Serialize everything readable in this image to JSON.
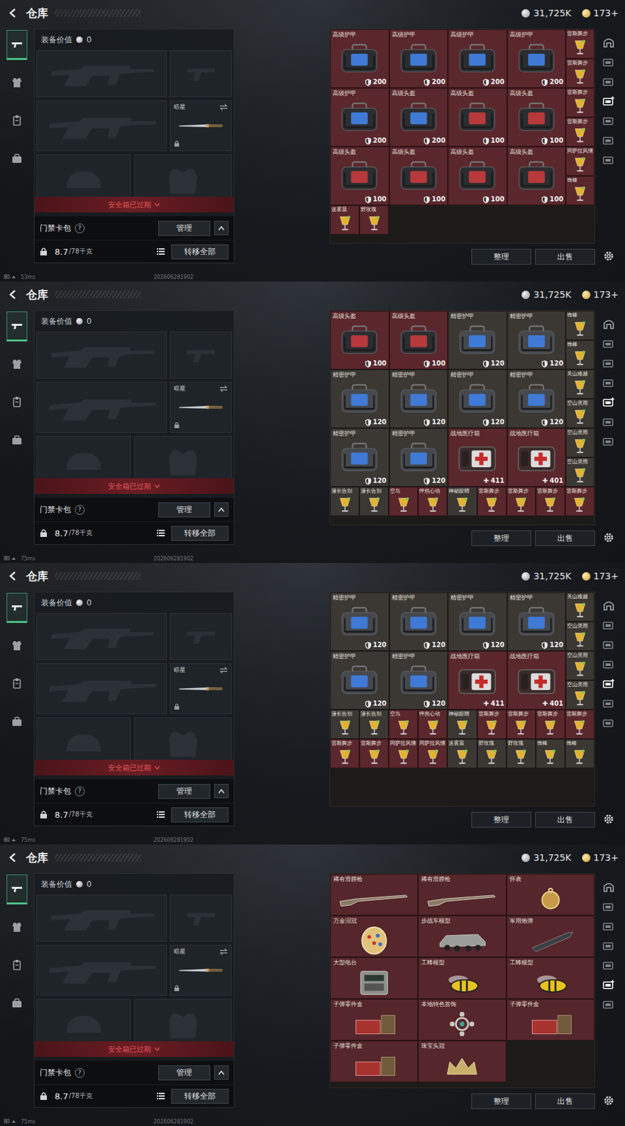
{
  "screens": [
    {
      "topbar": {
        "title": "仓库",
        "currencies": [
          {
            "kind": "silver",
            "value": "31,725K"
          },
          {
            "kind": "gold",
            "value": "173+"
          }
        ]
      },
      "nav": [
        {
          "kind": "weapon",
          "selected": true
        },
        {
          "kind": "armor",
          "selected": false
        },
        {
          "kind": "clipboard",
          "selected": false
        },
        {
          "kind": "case",
          "selected": false
        }
      ],
      "equipment": {
        "value_label": "装备价值",
        "value": "0",
        "slots": [
          {
            "kind": "rifle"
          },
          {
            "kind": "pistol"
          },
          {
            "kind": "rifle"
          },
          {
            "kind": "melee",
            "label": "暗星",
            "locked": true
          },
          {
            "kind": "helmet"
          },
          {
            "kind": "armor"
          }
        ],
        "warning": "安全箱已过期",
        "keycard": {
          "label": "门禁卡包",
          "help": "?",
          "manage": "管理"
        },
        "weight": "8.7",
        "capacity": "/78千克",
        "transfer": "转移全部"
      },
      "stash": {
        "layout": "gear",
        "big": [
          {
            "label": "高级护甲",
            "value": "200",
            "kind": "armor",
            "color": "#5a272d"
          },
          {
            "label": "高级护甲",
            "value": "200",
            "kind": "armor",
            "color": "#5a272d"
          },
          {
            "label": "高级护甲",
            "value": "200",
            "kind": "armor",
            "color": "#5a272d"
          },
          {
            "label": "高级护甲",
            "value": "200",
            "kind": "armor",
            "color": "#5a272d"
          },
          {
            "label": "高级护甲",
            "value": "200",
            "kind": "armor",
            "color": "#5a272d"
          },
          {
            "label": "高级头盔",
            "value": "200",
            "kind": "armor",
            "color": "#5a272d"
          },
          {
            "label": "高级头盔",
            "value": "100",
            "kind": "helmet",
            "color": "#5a272d"
          },
          {
            "label": "高级头盔",
            "value": "100",
            "kind": "helmet",
            "color": "#5a272d"
          },
          {
            "label": "高级头盔",
            "value": "100",
            "kind": "helmet",
            "color": "#5a272d"
          },
          {
            "label": "高级头盔",
            "value": "100",
            "kind": "helmet",
            "color": "#5a272d"
          },
          {
            "label": "高级头盔",
            "value": "100",
            "kind": "helmet",
            "color": "#5a272d"
          },
          {
            "label": "高级头盔",
            "value": "100",
            "kind": "helmet",
            "color": "#5a272d"
          }
        ],
        "side": [
          {
            "label": "雷斯舞步",
            "color": "#5a272d"
          },
          {
            "label": "雷斯舞步",
            "color": "#5a272d"
          },
          {
            "label": "雷斯舞步",
            "color": "#5a272d"
          },
          {
            "label": "雷斯舞步",
            "color": "#5a272d"
          },
          {
            "label": "同萨拉风情",
            "color": "#5a272d"
          },
          {
            "label": "饰棒",
            "color": "#5a272d"
          }
        ],
        "small": [
          {
            "label": "迷雾晨",
            "color": "#5a272d"
          },
          {
            "label": "野玫瑰",
            "color": "#5a272d"
          }
        ],
        "buttons": [
          "整理",
          "出售"
        ]
      },
      "tools": [
        {
          "highlighted": false
        },
        {
          "highlighted": false
        },
        {
          "highlighted": false
        },
        {
          "highlighted": true
        },
        {
          "highlighted": false
        },
        {
          "highlighted": false
        },
        {
          "highlighted": false
        }
      ],
      "status": {
        "ping": "53ms",
        "timestamp": "202606281902"
      }
    },
    {
      "topbar": {
        "title": "仓库",
        "currencies": [
          {
            "kind": "silver",
            "value": "31,725K"
          },
          {
            "kind": "gold",
            "value": "173+"
          }
        ]
      },
      "nav": [
        {
          "kind": "weapon",
          "selected": true
        },
        {
          "kind": "armor",
          "selected": false
        },
        {
          "kind": "clipboard",
          "selected": false
        },
        {
          "kind": "case",
          "selected": false
        }
      ],
      "equipment": {
        "value_label": "装备价值",
        "value": "0",
        "slots": [
          {
            "kind": "rifle"
          },
          {
            "kind": "pistol"
          },
          {
            "kind": "rifle"
          },
          {
            "kind": "melee",
            "label": "暗星",
            "locked": true
          },
          {
            "kind": "helmet"
          },
          {
            "kind": "armor"
          }
        ],
        "warning": "安全箱已过期",
        "keycard": {
          "label": "门禁卡包",
          "help": "?",
          "manage": "管理"
        },
        "weight": "8.7",
        "capacity": "/78千克",
        "transfer": "转移全部"
      },
      "stash": {
        "layout": "gear",
        "big": [
          {
            "label": "高级头盔",
            "value": "100",
            "kind": "helmet",
            "color": "#5a272d"
          },
          {
            "label": "高级头盔",
            "value": "100",
            "kind": "helmet",
            "color": "#5a272d"
          },
          {
            "label": "精密护甲",
            "value": "120",
            "kind": "precise",
            "color": "#3b3733"
          },
          {
            "label": "精密护甲",
            "value": "120",
            "kind": "precise",
            "color": "#3b3733"
          },
          {
            "label": "精密护甲",
            "value": "120",
            "kind": "precise",
            "color": "#3b3733"
          },
          {
            "label": "精密护甲",
            "value": "120",
            "kind": "precise",
            "color": "#3b3733"
          },
          {
            "label": "精密护甲",
            "value": "120",
            "kind": "precise",
            "color": "#3b3733"
          },
          {
            "label": "精密护甲",
            "value": "120",
            "kind": "precise",
            "color": "#3b3733"
          },
          {
            "label": "精密护甲",
            "value": "120",
            "kind": "precise",
            "color": "#3b3733"
          },
          {
            "label": "精密护甲",
            "value": "120",
            "kind": "precise",
            "color": "#3b3733"
          },
          {
            "label": "战地医疗箱",
            "value": "411",
            "mark": "✚",
            "kind": "medkit",
            "color": "#5a272d"
          },
          {
            "label": "战地医疗箱",
            "value": "401",
            "mark": "✚",
            "kind": "medkit",
            "color": "#5a272d"
          }
        ],
        "side": [
          {
            "label": "饰棒",
            "color": "#3b3733"
          },
          {
            "label": "饰棒",
            "color": "#3b3733"
          },
          {
            "label": "关山难越",
            "color": "#3b3733"
          },
          {
            "label": "空山灵雨",
            "color": "#3b3733"
          },
          {
            "label": "空山灵雨",
            "color": "#3b3733"
          },
          {
            "label": "空山灵雨",
            "color": "#3b3733"
          }
        ],
        "small": [
          {
            "label": "漫长告别",
            "color": "#3b3733"
          },
          {
            "label": "漫长告别",
            "color": "#3b3733"
          },
          {
            "label": "空岛",
            "color": "#5a272d"
          },
          {
            "label": "怦然心动",
            "color": "#5a272d"
          },
          {
            "label": "神秘眼睛",
            "color": "#3b3733"
          },
          {
            "label": "雷斯舞步",
            "color": "#5a272d"
          },
          {
            "label": "雷斯舞步",
            "color": "#5a272d"
          },
          {
            "label": "雷斯舞步",
            "color": "#5a272d"
          },
          {
            "label": "雷斯舞步",
            "color": "#5a272d"
          }
        ],
        "buttons": [
          "整理",
          "出售"
        ]
      },
      "tools": [
        {
          "highlighted": false
        },
        {
          "highlighted": false
        },
        {
          "highlighted": false
        },
        {
          "highlighted": false
        },
        {
          "highlighted": true
        },
        {
          "highlighted": false
        },
        {
          "highlighted": false
        }
      ],
      "status": {
        "ping": "75ms",
        "timestamp": "202606281902"
      }
    },
    {
      "topbar": {
        "title": "仓库",
        "currencies": [
          {
            "kind": "silver",
            "value": "31,725K"
          },
          {
            "kind": "gold",
            "value": "173+"
          }
        ]
      },
      "nav": [
        {
          "kind": "weapon",
          "selected": true
        },
        {
          "kind": "armor",
          "selected": false
        },
        {
          "kind": "clipboard",
          "selected": false
        },
        {
          "kind": "case",
          "selected": false
        }
      ],
      "equipment": {
        "value_label": "装备价值",
        "value": "0",
        "slots": [
          {
            "kind": "rifle"
          },
          {
            "kind": "pistol"
          },
          {
            "kind": "rifle"
          },
          {
            "kind": "melee",
            "label": "暗星",
            "locked": true
          },
          {
            "kind": "helmet"
          },
          {
            "kind": "armor"
          }
        ],
        "warning": "安全箱已过期",
        "keycard": {
          "label": "门禁卡包",
          "help": "?",
          "manage": "管理"
        },
        "weight": "8.7",
        "capacity": "/78千克",
        "transfer": "转移全部"
      },
      "stash": {
        "layout": "gear",
        "big": [
          {
            "label": "精密护甲",
            "value": "120",
            "kind": "precise",
            "color": "#3b3733"
          },
          {
            "label": "精密护甲",
            "value": "120",
            "kind": "precise",
            "color": "#3b3733"
          },
          {
            "label": "精密护甲",
            "value": "120",
            "kind": "precise",
            "color": "#3b3733"
          },
          {
            "label": "精密护甲",
            "value": "120",
            "kind": "precise",
            "color": "#3b3733"
          },
          {
            "label": "精密护甲",
            "value": "120",
            "kind": "precise",
            "color": "#3b3733"
          },
          {
            "label": "精密护甲",
            "value": "120",
            "kind": "precise",
            "color": "#3b3733"
          },
          {
            "label": "战地医疗箱",
            "value": "411",
            "mark": "✚",
            "kind": "medkit",
            "color": "#5a272d"
          },
          {
            "label": "战地医疗箱",
            "value": "401",
            "mark": "✚",
            "kind": "medkit",
            "color": "#5a272d"
          }
        ],
        "side": [
          {
            "label": "关山难越",
            "color": "#3b3733"
          },
          {
            "label": "空山灵雨",
            "color": "#3b3733"
          },
          {
            "label": "空山灵雨",
            "color": "#3b3733"
          },
          {
            "label": "空山灵雨",
            "color": "#3b3733"
          }
        ],
        "small": [
          {
            "label": "漫长告别",
            "color": "#3b3733"
          },
          {
            "label": "漫长告别",
            "color": "#3b3733"
          },
          {
            "label": "空岛",
            "color": "#5a272d"
          },
          {
            "label": "怦然心动",
            "color": "#5a272d"
          },
          {
            "label": "神秘眼睛",
            "color": "#3b3733"
          },
          {
            "label": "雷斯舞步",
            "color": "#5a272d"
          },
          {
            "label": "雷斯舞步",
            "color": "#5a272d"
          },
          {
            "label": "雷斯舞步",
            "color": "#5a272d"
          },
          {
            "label": "雷斯舞步",
            "color": "#5a272d"
          },
          {
            "label": "雷斯舞步",
            "color": "#5a272d"
          },
          {
            "label": "雷斯舞步",
            "color": "#5a272d"
          },
          {
            "label": "同萨拉风情",
            "color": "#5a272d"
          },
          {
            "label": "同萨拉风情",
            "color": "#5a272d"
          },
          {
            "label": "迷雾晨",
            "color": "#3b3733"
          },
          {
            "label": "野玫瑰",
            "color": "#3b3733"
          },
          {
            "label": "野玫瑰",
            "color": "#3b3733"
          },
          {
            "label": "饰棒",
            "color": "#3b3733"
          },
          {
            "label": "饰棒",
            "color": "#3b3733"
          }
        ],
        "buttons": [
          "整理",
          "出售"
        ]
      },
      "tools": [
        {
          "highlighted": false
        },
        {
          "highlighted": false
        },
        {
          "highlighted": false
        },
        {
          "highlighted": false
        },
        {
          "highlighted": true
        },
        {
          "highlighted": false
        },
        {
          "highlighted": false
        }
      ],
      "status": {
        "ping": "75ms",
        "timestamp": "202606281902"
      }
    },
    {
      "topbar": {
        "title": "仓库",
        "currencies": [
          {
            "kind": "silver",
            "value": "31,725K"
          },
          {
            "kind": "gold",
            "value": "173+"
          }
        ]
      },
      "nav": [
        {
          "kind": "weapon",
          "selected": true
        },
        {
          "kind": "armor",
          "selected": false
        },
        {
          "kind": "clipboard",
          "selected": false
        },
        {
          "kind": "case",
          "selected": false
        }
      ],
      "equipment": {
        "value_label": "装备价值",
        "value": "0",
        "slots": [
          {
            "kind": "rifle"
          },
          {
            "kind": "pistol"
          },
          {
            "kind": "rifle"
          },
          {
            "kind": "melee",
            "label": "暗星",
            "locked": true
          },
          {
            "kind": "helmet"
          },
          {
            "kind": "armor"
          }
        ],
        "warning": "安全箱已过期",
        "keycard": {
          "label": "门禁卡包",
          "help": "?",
          "manage": "管理"
        },
        "weight": "8.7",
        "capacity": "/78千克",
        "transfer": "转移全部"
      },
      "stash": {
        "layout": "collection",
        "items": [
          {
            "label": "稀有滑膛枪",
            "kind": "musket"
          },
          {
            "label": "稀有滑膛枪",
            "kind": "musket"
          },
          {
            "label": "怀表",
            "kind": "watch"
          },
          {
            "label": "万金泪冠",
            "kind": "egg"
          },
          {
            "label": "步战车模型",
            "kind": "vehicle"
          },
          {
            "label": "军用炮弹",
            "kind": "shell"
          },
          {
            "label": "大型电台",
            "kind": "radio"
          },
          {
            "label": "工蜂模型",
            "kind": "bee"
          },
          {
            "label": "工蜂模型",
            "kind": "bee"
          },
          {
            "label": "子弹零件盒",
            "kind": "ammo"
          },
          {
            "label": "本地特色首饰",
            "kind": "jewelry"
          },
          {
            "label": "子弹零件盒",
            "kind": "ammo"
          },
          {
            "label": "子弹零件盒",
            "kind": "ammo"
          },
          {
            "label": "珠宝头冠",
            "kind": "crown"
          }
        ],
        "buttons": [
          "整理",
          "出售"
        ]
      },
      "tools": [
        {
          "highlighted": false
        },
        {
          "highlighted": false
        },
        {
          "highlighted": false
        },
        {
          "highlighted": false
        },
        {
          "highlighted": false
        },
        {
          "highlighted": true
        },
        {
          "highlighted": false
        }
      ],
      "status": {
        "ping": "75ms",
        "timestamp": "202606281902"
      }
    }
  ]
}
